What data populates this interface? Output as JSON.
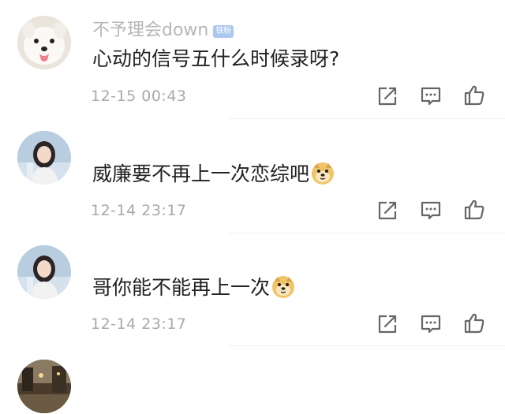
{
  "comments": [
    {
      "username": "不予理会down",
      "badge": "铁粉",
      "text": "心动的信号五什么时候录呀?",
      "time": "12-15 00:43",
      "avatar": "dog-avatar",
      "emoji": null
    },
    {
      "username": "",
      "text": "威廉要不再上一次恋综吧",
      "time": "12-14 23:17",
      "avatar": "girl-avatar",
      "emoji": "doge-emoji"
    },
    {
      "username": "",
      "text": "哥你能不能再上一次",
      "time": "12-14 23:17",
      "avatar": "girl-avatar",
      "emoji": "doge-emoji"
    },
    {
      "username": "",
      "text": "",
      "time": "",
      "avatar": "street-avatar",
      "emoji": null
    }
  ],
  "actions": [
    "share-icon",
    "comment-icon",
    "like-icon"
  ],
  "colors": {
    "username": "#b7b7b7",
    "text": "#222222",
    "time": "#a9a9a9",
    "icon": "#666666",
    "badge": "#a9c7ef"
  }
}
